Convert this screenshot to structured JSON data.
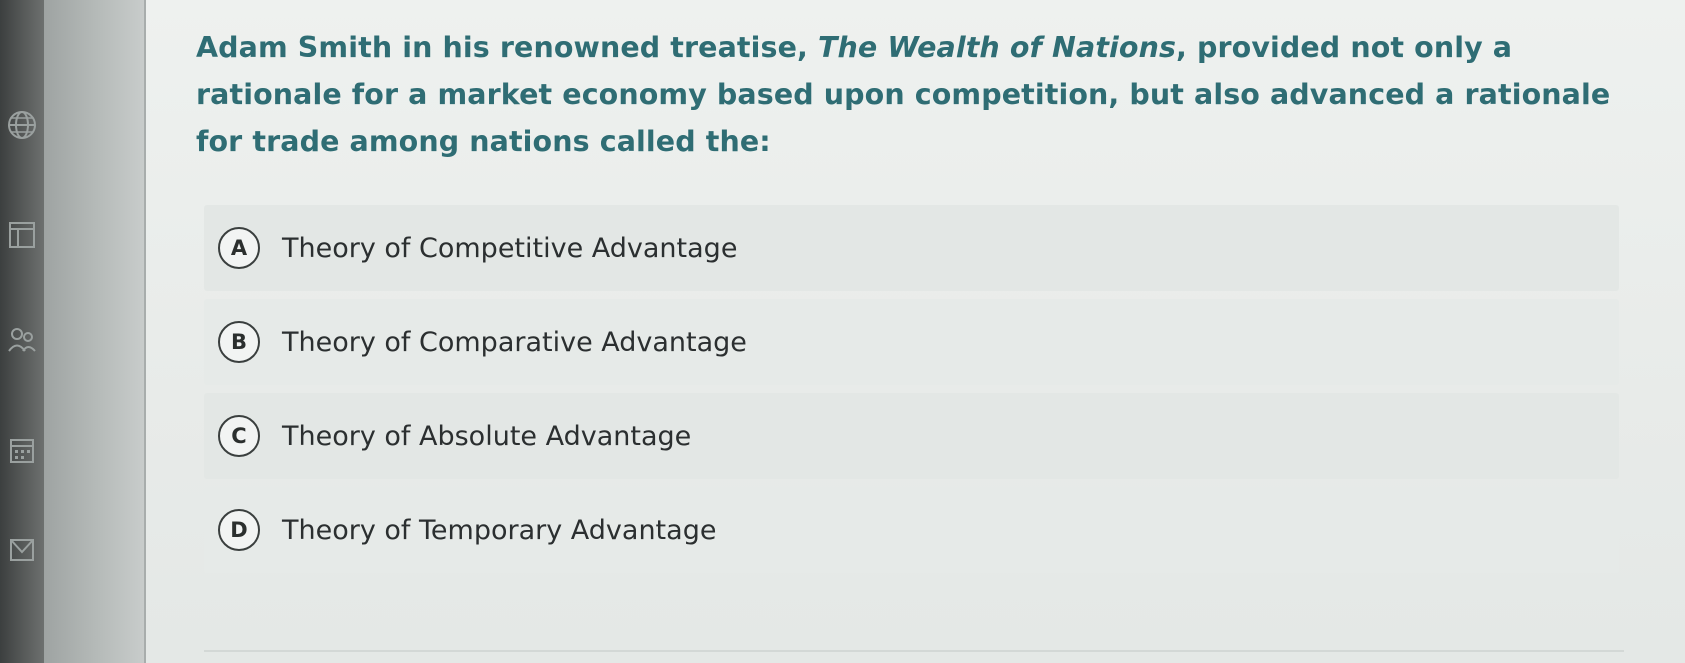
{
  "question": {
    "text_before": "Adam Smith in his renowned treatise, ",
    "title_italic": "The Wealth of Nations",
    "text_after": ", provided not only a rationale for a market economy based upon competition, but also advanced a rationale for trade among nations called the:"
  },
  "options": [
    {
      "letter": "A",
      "label": "Theory of Competitive Advantage"
    },
    {
      "letter": "B",
      "label": "Theory of Comparative Advantage"
    },
    {
      "letter": "C",
      "label": "Theory of Absolute Advantage"
    },
    {
      "letter": "D",
      "label": "Theory of Temporary Advantage"
    }
  ],
  "sidebar_icons": [
    "globe-icon",
    "layout-icon",
    "people-icon",
    "calendar-icon",
    "inbox-icon"
  ],
  "colors": {
    "question_text": "#2f6d74",
    "option_text": "#2b2f30"
  }
}
